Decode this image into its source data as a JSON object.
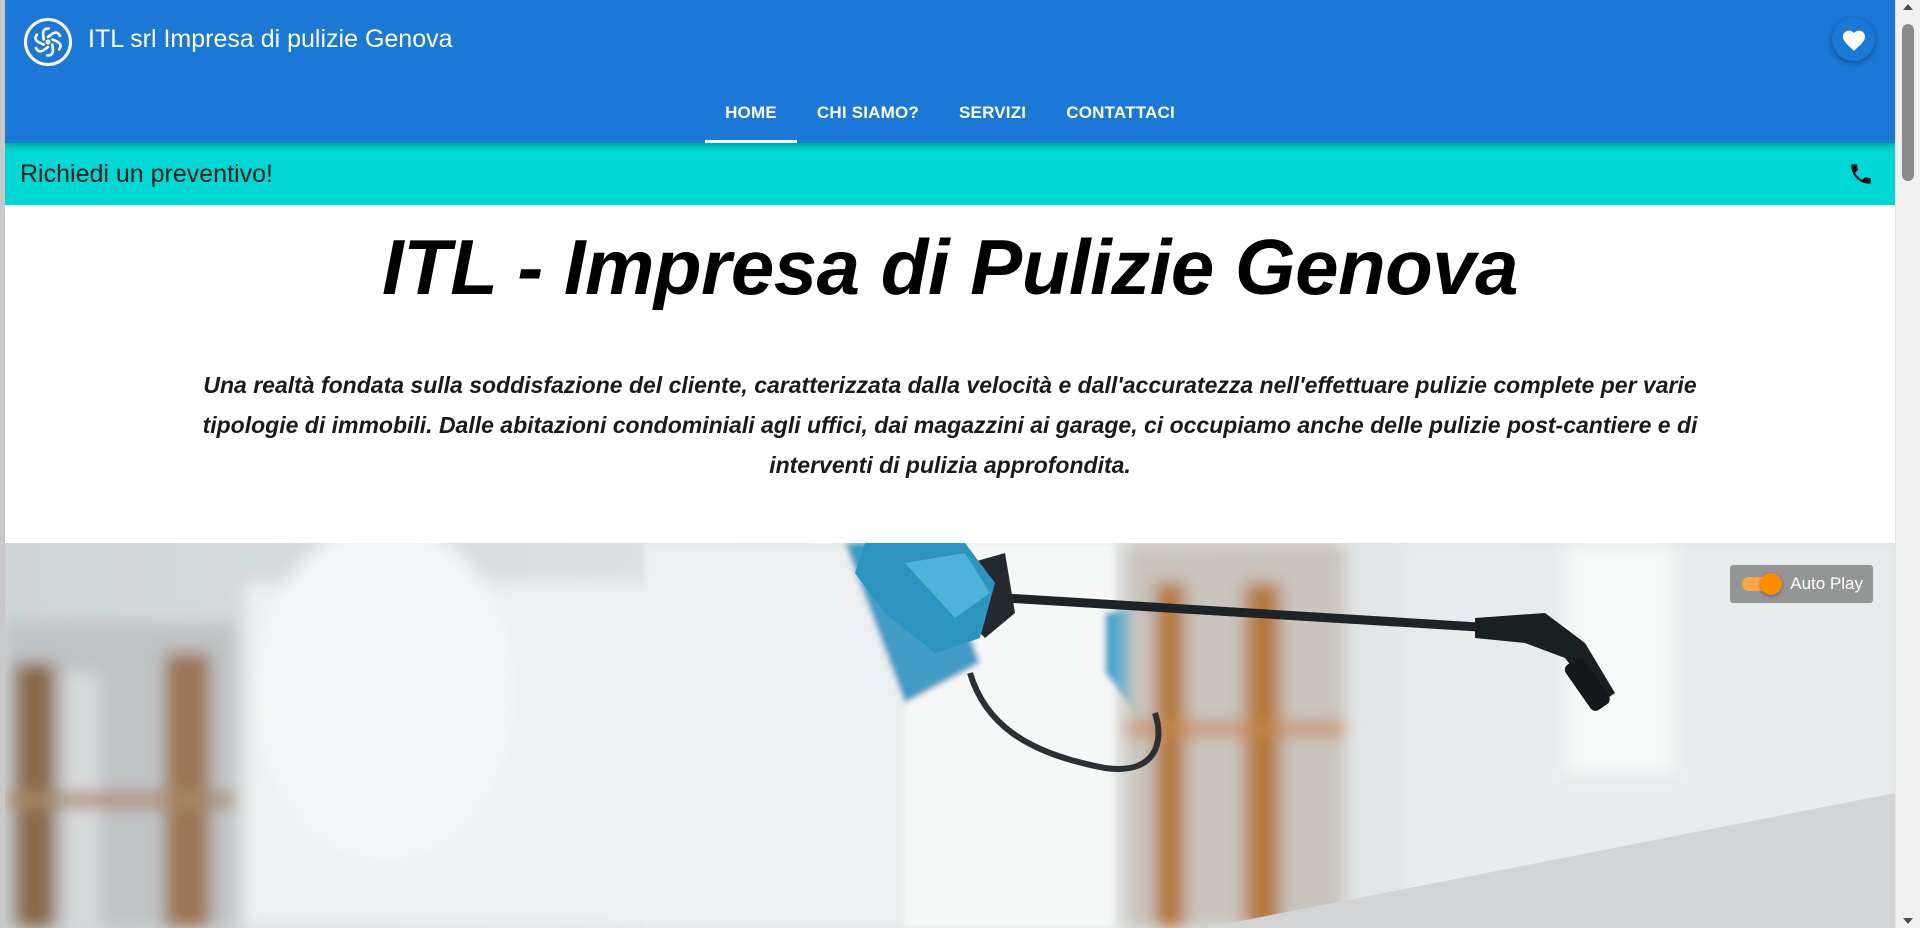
{
  "header": {
    "site_title": "ITL srl Impresa di pulizie Genova",
    "logo_icon": "swirl-logo-icon",
    "favorite_icon": "heart-icon"
  },
  "nav": {
    "tabs": [
      {
        "label": "HOME",
        "active": true
      },
      {
        "label": "CHI SIAMO?",
        "active": false
      },
      {
        "label": "SERVIZI",
        "active": false
      },
      {
        "label": "CONTATTACI",
        "active": false
      }
    ]
  },
  "quote_bar": {
    "text": "Richiedi un preventivo!",
    "icon": "phone-icon"
  },
  "main": {
    "title": "ITL - Impresa di Pulizie Genova",
    "intro": "Una realtà fondata sulla soddisfazione del cliente, caratterizzata dalla velocità e dall'accuratezza nell'effettuare pulizie complete per varie tipologie di immobili. Dalle abitazioni condominiali agli uffici, dai magazzini ai garage, ci occupiamo anche delle pulizie post-cantiere e di interventi di pulizia approfondita."
  },
  "slideshow": {
    "autoplay_label": "Auto Play",
    "autoplay_on": true
  },
  "colors": {
    "header_bg": "#1b78d6",
    "quote_bar_bg": "#00d8d6",
    "toggle_accent": "#ff8c00"
  }
}
